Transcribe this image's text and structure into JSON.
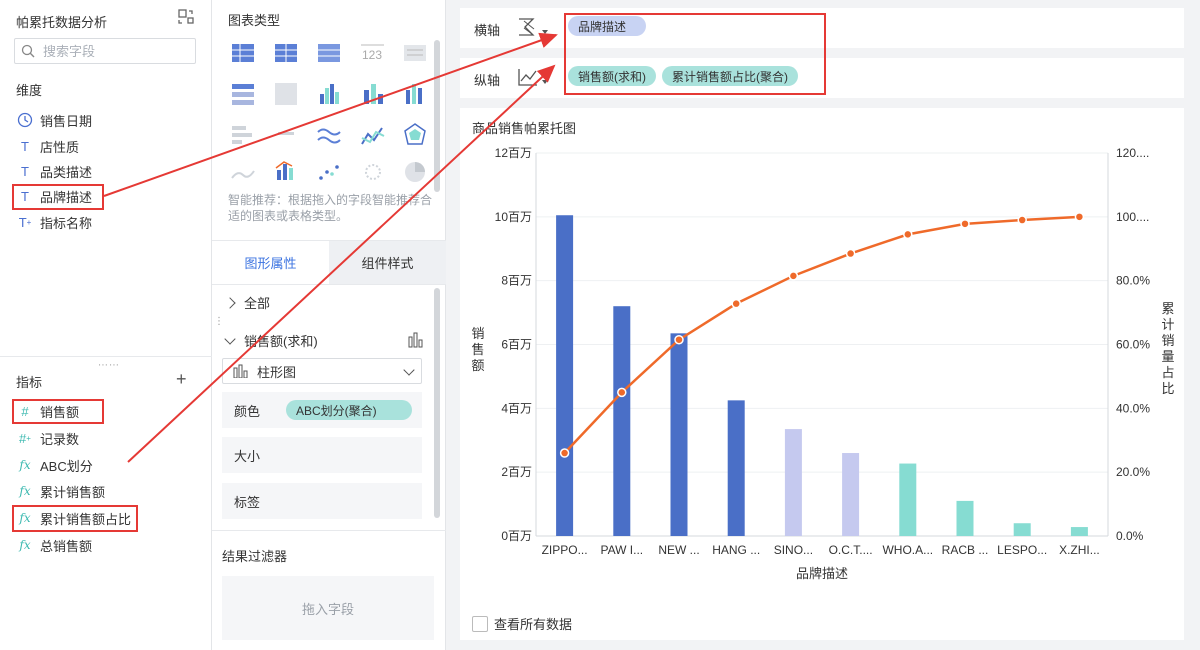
{
  "left": {
    "title": "帕累托数据分析",
    "search_placeholder": "搜索字段",
    "dimension_label": "维度",
    "dimensions": [
      {
        "label": "销售日期",
        "icon": "clock-icon"
      },
      {
        "label": "店性质",
        "icon": "text-type-icon"
      },
      {
        "label": "品类描述",
        "icon": "text-type-icon"
      },
      {
        "label": "品牌描述",
        "icon": "text-type-icon"
      },
      {
        "label": "指标名称",
        "icon": "text-type-icon"
      }
    ],
    "measure_label": "指标",
    "measures": [
      {
        "label": "销售额",
        "icon": "hash-icon"
      },
      {
        "label": "记录数",
        "icon": "hash-icon"
      },
      {
        "label": "ABC划分",
        "icon": "formula-icon"
      },
      {
        "label": "累计销售额",
        "icon": "formula-icon"
      },
      {
        "label": "累计销售额占比",
        "icon": "formula-icon"
      },
      {
        "label": "总销售额",
        "icon": "formula-icon"
      }
    ]
  },
  "middle": {
    "chart_type_title": "图表类型",
    "smart_hint": "智能推荐：根据拖入的字段智能推荐合适的图表或表格类型。",
    "tabs": [
      "图形属性",
      "组件样式"
    ],
    "all_label": "全部",
    "measure_section": "销售额(求和)",
    "chart_kind": "柱形图",
    "color_label": "颜色",
    "color_pill": "ABC划分(聚合)",
    "size_label": "大小",
    "tag_label": "标签",
    "filter_title": "结果过滤器",
    "drop_hint": "拖入字段"
  },
  "axes": {
    "x_label": "横轴",
    "x_pills": [
      "品牌描述"
    ],
    "y_label": "纵轴",
    "y_pills": [
      "销售额(求和)",
      "累计销售额占比(聚合)"
    ]
  },
  "chart_panel": {
    "view_all": "查看所有数据"
  },
  "colors": {
    "bar_a": "#4a6fc7",
    "bar_b": "#c5c9ef",
    "bar_c": "#86dcd2",
    "line": "#ef6a2a",
    "highlight": "#e53935"
  },
  "chart_data": {
    "type": "bar",
    "title": "商品销售帕累托图",
    "xlabel": "品牌描述",
    "ylabel": "销售额",
    "y2label": "累计销量占比",
    "categories": [
      "ZIPPO...",
      "PAW I...",
      "NEW ...",
      "HANG ...",
      "SINO...",
      "O.C.T....",
      "WHO.A...",
      "RACB ...",
      "LESPO...",
      "X.ZHI..."
    ],
    "y_ticks": [
      "0百万",
      "2百万",
      "4百万",
      "6百万",
      "8百万",
      "10百万",
      "12百万"
    ],
    "y2_ticks": [
      "0.0%",
      "20.0%",
      "40.0%",
      "60.0%",
      "80.0%",
      "100....",
      "120...."
    ],
    "ylim": [
      0,
      12000000
    ],
    "y2lim": [
      0,
      120
    ],
    "series": [
      {
        "type": "bar",
        "values": [
          10050000,
          7200000,
          6350000,
          4250000,
          3350000,
          2600000,
          2270000,
          1100000,
          400000,
          280000
        ],
        "groups": [
          "A",
          "A",
          "A",
          "A",
          "B",
          "B",
          "C",
          "C",
          "C",
          "C"
        ]
      },
      {
        "type": "line",
        "values": [
          26.0,
          45.0,
          61.5,
          72.8,
          81.5,
          88.5,
          94.5,
          97.8,
          99.0,
          100.0
        ]
      }
    ],
    "grid": true
  }
}
